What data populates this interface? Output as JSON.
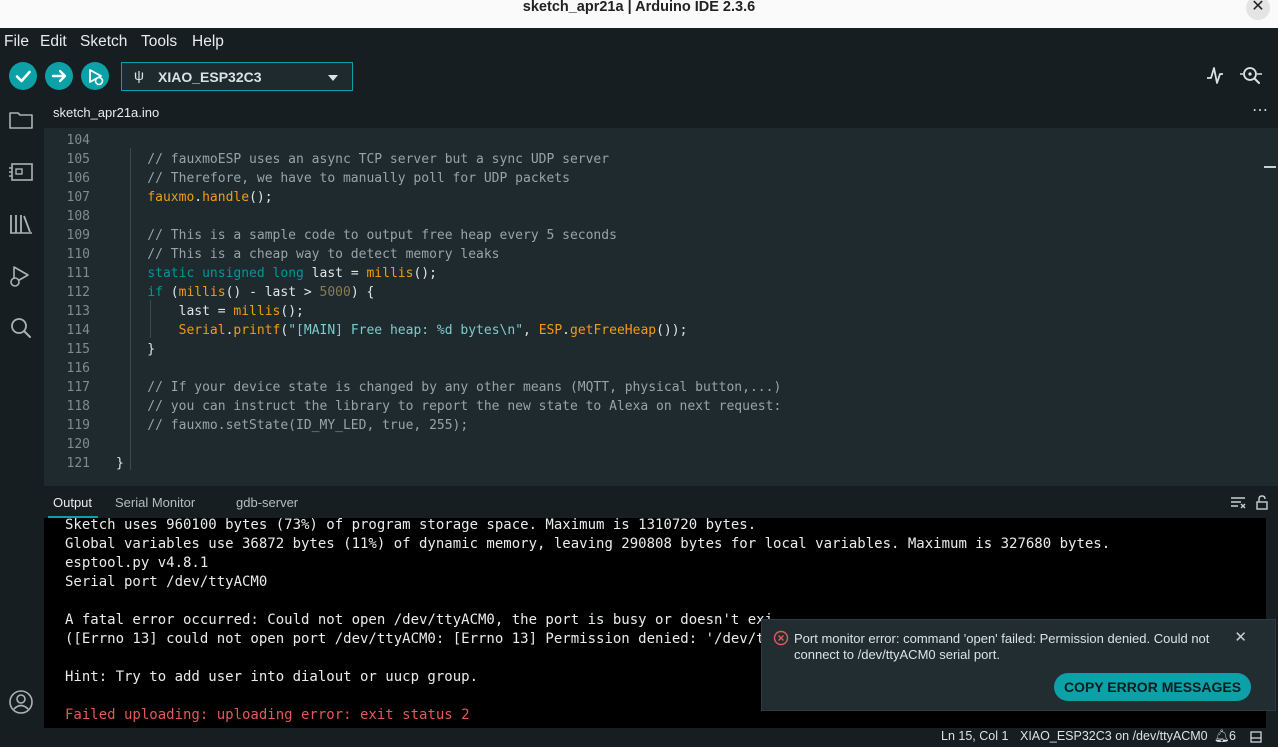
{
  "window": {
    "title": "sketch_apr21a | Arduino IDE 2.3.6"
  },
  "menu": {
    "items": [
      "File",
      "Edit",
      "Sketch",
      "Tools",
      "Help"
    ]
  },
  "toolbar": {
    "board": "XIAO_ESP32C3",
    "icons": {
      "verify": "check-icon",
      "upload": "arrow-right-icon",
      "debug": "debug-icon",
      "plotter": "serial-plotter-icon",
      "monitor": "serial-monitor-icon"
    }
  },
  "activitybar": {
    "icons": [
      "folder-icon",
      "boards-manager-icon",
      "library-icon",
      "debug-icon",
      "search-icon",
      "account-icon"
    ]
  },
  "editor": {
    "tab": "sketch_apr21a.ino",
    "lines": [
      {
        "n": "104",
        "tokens": []
      },
      {
        "n": "105",
        "tokens": [
          {
            "t": "    // fauxmoESP uses an async TCP server but a sync UDP server",
            "c": "cm"
          }
        ]
      },
      {
        "n": "106",
        "tokens": [
          {
            "t": "    // Therefore, we have to manually poll for UDP packets",
            "c": "cm"
          }
        ]
      },
      {
        "n": "107",
        "tokens": [
          {
            "t": "    ",
            "c": ""
          },
          {
            "t": "fauxmo",
            "c": "fn"
          },
          {
            "t": ".",
            "c": ""
          },
          {
            "t": "handle",
            "c": "fn"
          },
          {
            "t": "();",
            "c": ""
          }
        ]
      },
      {
        "n": "108",
        "tokens": []
      },
      {
        "n": "109",
        "tokens": [
          {
            "t": "    // This is a sample code to output free heap every 5 seconds",
            "c": "cm"
          }
        ]
      },
      {
        "n": "110",
        "tokens": [
          {
            "t": "    // This is a cheap way to detect memory leaks",
            "c": "cm"
          }
        ]
      },
      {
        "n": "111",
        "tokens": [
          {
            "t": "    ",
            "c": ""
          },
          {
            "t": "static unsigned long",
            "c": "kw"
          },
          {
            "t": " last = ",
            "c": ""
          },
          {
            "t": "millis",
            "c": "fn"
          },
          {
            "t": "();",
            "c": ""
          }
        ]
      },
      {
        "n": "112",
        "tokens": [
          {
            "t": "    ",
            "c": ""
          },
          {
            "t": "if",
            "c": "kw"
          },
          {
            "t": " (",
            "c": ""
          },
          {
            "t": "millis",
            "c": "fn"
          },
          {
            "t": "() - last > ",
            "c": ""
          },
          {
            "t": "5000",
            "c": "nm"
          },
          {
            "t": ") {",
            "c": ""
          }
        ]
      },
      {
        "n": "113",
        "tokens": [
          {
            "t": "        last = ",
            "c": ""
          },
          {
            "t": "millis",
            "c": "fn"
          },
          {
            "t": "();",
            "c": ""
          }
        ]
      },
      {
        "n": "114",
        "tokens": [
          {
            "t": "        ",
            "c": ""
          },
          {
            "t": "Serial",
            "c": "fn"
          },
          {
            "t": ".",
            "c": ""
          },
          {
            "t": "printf",
            "c": "fn"
          },
          {
            "t": "(",
            "c": ""
          },
          {
            "t": "\"[MAIN] Free heap: %d bytes\\n\"",
            "c": "str"
          },
          {
            "t": ", ",
            "c": ""
          },
          {
            "t": "ESP",
            "c": "fn"
          },
          {
            "t": ".",
            "c": ""
          },
          {
            "t": "getFreeHeap",
            "c": "fn"
          },
          {
            "t": "());",
            "c": ""
          }
        ]
      },
      {
        "n": "115",
        "tokens": [
          {
            "t": "    }",
            "c": ""
          }
        ]
      },
      {
        "n": "116",
        "tokens": []
      },
      {
        "n": "117",
        "tokens": [
          {
            "t": "    // If your device state is changed by any other means (MQTT, physical button,...)",
            "c": "cm"
          }
        ]
      },
      {
        "n": "118",
        "tokens": [
          {
            "t": "    // you can instruct the library to report the new state to Alexa on next request:",
            "c": "cm"
          }
        ]
      },
      {
        "n": "119",
        "tokens": [
          {
            "t": "    // fauxmo.setState(ID_MY_LED, true, 255);",
            "c": "cm"
          }
        ]
      },
      {
        "n": "120",
        "tokens": []
      },
      {
        "n": "121",
        "tokens": [
          {
            "t": "}",
            "c": ""
          }
        ]
      }
    ]
  },
  "panel": {
    "tabs": [
      "Output",
      "Serial Monitor",
      "gdb-server"
    ],
    "output_lines": [
      {
        "text": "Sketch uses 960100 bytes (73%) of program storage space. Maximum is 1310720 bytes.",
        "error": false
      },
      {
        "text": "Global variables use 36872 bytes (11%) of dynamic memory, leaving 290808 bytes for local variables. Maximum is 327680 bytes.",
        "error": false
      },
      {
        "text": "esptool.py v4.8.1",
        "error": false
      },
      {
        "text": "Serial port /dev/ttyACM0",
        "error": false
      },
      {
        "text": "",
        "error": false
      },
      {
        "text": "A fatal error occurred: Could not open /dev/ttyACM0, the port is busy or doesn't exi",
        "error": false
      },
      {
        "text": "([Errno 13] could not open port /dev/ttyACM0: [Errno 13] Permission denied: '/dev/t",
        "error": false
      },
      {
        "text": "",
        "error": false
      },
      {
        "text": "Hint: Try to add user into dialout or uucp group.",
        "error": false
      },
      {
        "text": "",
        "error": false
      },
      {
        "text": "Failed uploading: uploading error: exit status 2",
        "error": true
      }
    ]
  },
  "notification": {
    "message": "Port monitor error: command 'open' failed: Permission denied. Could not connect to /dev/ttyACM0 serial port.",
    "button": "COPY ERROR MESSAGES"
  },
  "status": {
    "position": "Ln 15, Col 1",
    "board_port": "XIAO_ESP32C3 on /dev/ttyACM0",
    "notifications_count": "6"
  },
  "colors": {
    "accent": "#0ca1a6",
    "error": "#e05a5a",
    "editor_bg": "#1e2a2e"
  }
}
